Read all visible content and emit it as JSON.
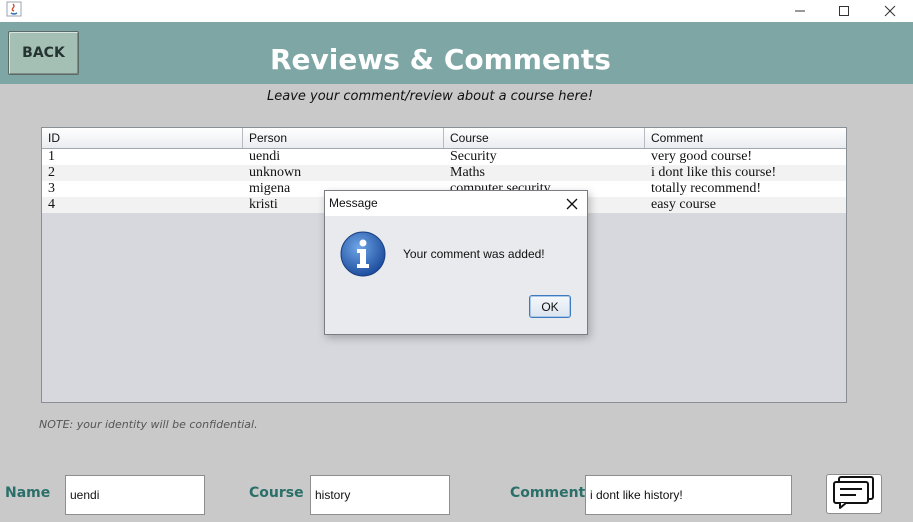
{
  "window": {
    "controls": {
      "minimize": "minimize-icon",
      "maximize": "maximize-icon",
      "close": "close-icon"
    }
  },
  "header": {
    "back_label": "BACK",
    "title": "Reviews & Comments",
    "subtitle": "Leave your comment/review about a course here!",
    "bg_color": "#7da6a4"
  },
  "table": {
    "columns": [
      "ID",
      "Person",
      "Course",
      "Comment"
    ],
    "rows": [
      [
        "1",
        "uendi",
        "Security",
        "very good course!"
      ],
      [
        "2",
        "unknown",
        "Maths",
        "i dont like this course!"
      ],
      [
        "3",
        "migena",
        "computer security",
        "totally recommend!"
      ],
      [
        "4",
        "kristi",
        "",
        "easy course"
      ]
    ]
  },
  "note": "NOTE: your identity will be confidential.",
  "form": {
    "name_label": "Name",
    "name_value": "uendi",
    "course_label": "Course",
    "course_value": "history",
    "comment_label": "Comment",
    "comment_value": "i dont like history!",
    "submit_icon": "chat-icon",
    "label_color": "#2b6f6a"
  },
  "dialog": {
    "title": "Message",
    "message": "Your comment was added!",
    "ok_label": "OK",
    "icon": "info-icon"
  }
}
